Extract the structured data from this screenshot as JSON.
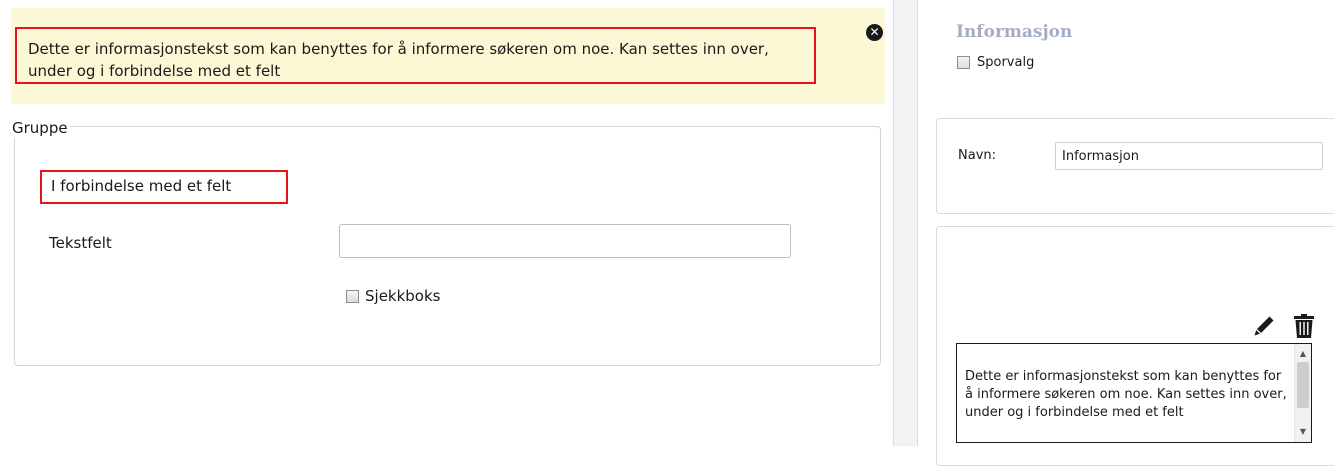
{
  "banner": {
    "text": "Dette er informasjonstekst som kan benyttes for å informere søkeren om noe. Kan settes inn over, under og i forbindelse med et felt",
    "close_icon": "close-circle-icon",
    "background": "#fcf8d6",
    "highlight_color": "#e4131c"
  },
  "group": {
    "legend": "Gruppe",
    "highlight_label": "I forbindelse med et felt",
    "text_field": {
      "label": "Tekstfelt",
      "value": "",
      "placeholder": ""
    },
    "checkbox": {
      "label": "Sjekkboks",
      "checked": false
    }
  },
  "properties": {
    "title": "Informasjon",
    "title_color": "#a6acc6",
    "sporvalg": {
      "label": "Sporvalg",
      "checked": false
    },
    "name": {
      "label": "Navn:",
      "value": "Informasjon"
    },
    "edit_icon": "pencil-icon",
    "delete_icon": "trash-icon",
    "text": "Dette er informasjonstekst som kan benyttes for å informere søkeren om noe. Kan settes inn over, under og i forbindelse med et felt"
  }
}
